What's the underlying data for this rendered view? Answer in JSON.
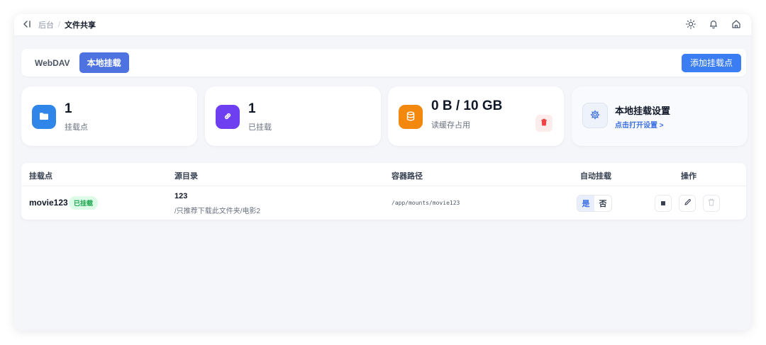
{
  "topbar": {
    "breadcrumb_parent": "后台",
    "breadcrumb_separator": "/",
    "breadcrumb_current": "文件共享",
    "icons": [
      "sidebar-collapse-icon",
      "sun-icon",
      "bell-icon",
      "home-icon"
    ]
  },
  "tabs": {
    "items": [
      {
        "label": "WebDAV",
        "active": false
      },
      {
        "label": "本地挂载",
        "active": true
      }
    ],
    "add_button_label": "添加挂载点"
  },
  "stats": [
    {
      "value": "1",
      "label": "挂载点",
      "icon": "folder-icon",
      "color": "#2f86e8"
    },
    {
      "value": "1",
      "label": "已挂载",
      "icon": "link-icon",
      "color": "#6e3ff0"
    },
    {
      "value": "0 B / 10 GB",
      "label": "读缓存占用",
      "icon": "database-icon",
      "color": "#f2880e"
    }
  ],
  "settings_card": {
    "title": "本地挂载设置",
    "link_label": "点击打开设置 >"
  },
  "table": {
    "headers": {
      "mount": "挂载点",
      "source": "源目录",
      "container": "容器路径",
      "auto_mount": "自动挂载",
      "actions": "操作"
    },
    "rows": [
      {
        "name": "movie123",
        "status": "已挂载",
        "source_title": "123",
        "source_path": "/只推荐下载此文件夹/电影2",
        "container_path": "/app/mounts/movie123",
        "auto_yes": "是",
        "auto_no": "否",
        "auto_mount": true
      }
    ]
  },
  "colors": {
    "accent": "#3b7df2",
    "tab_active": "#4e73e0",
    "success": "#16a34a",
    "danger": "#ef4444"
  }
}
